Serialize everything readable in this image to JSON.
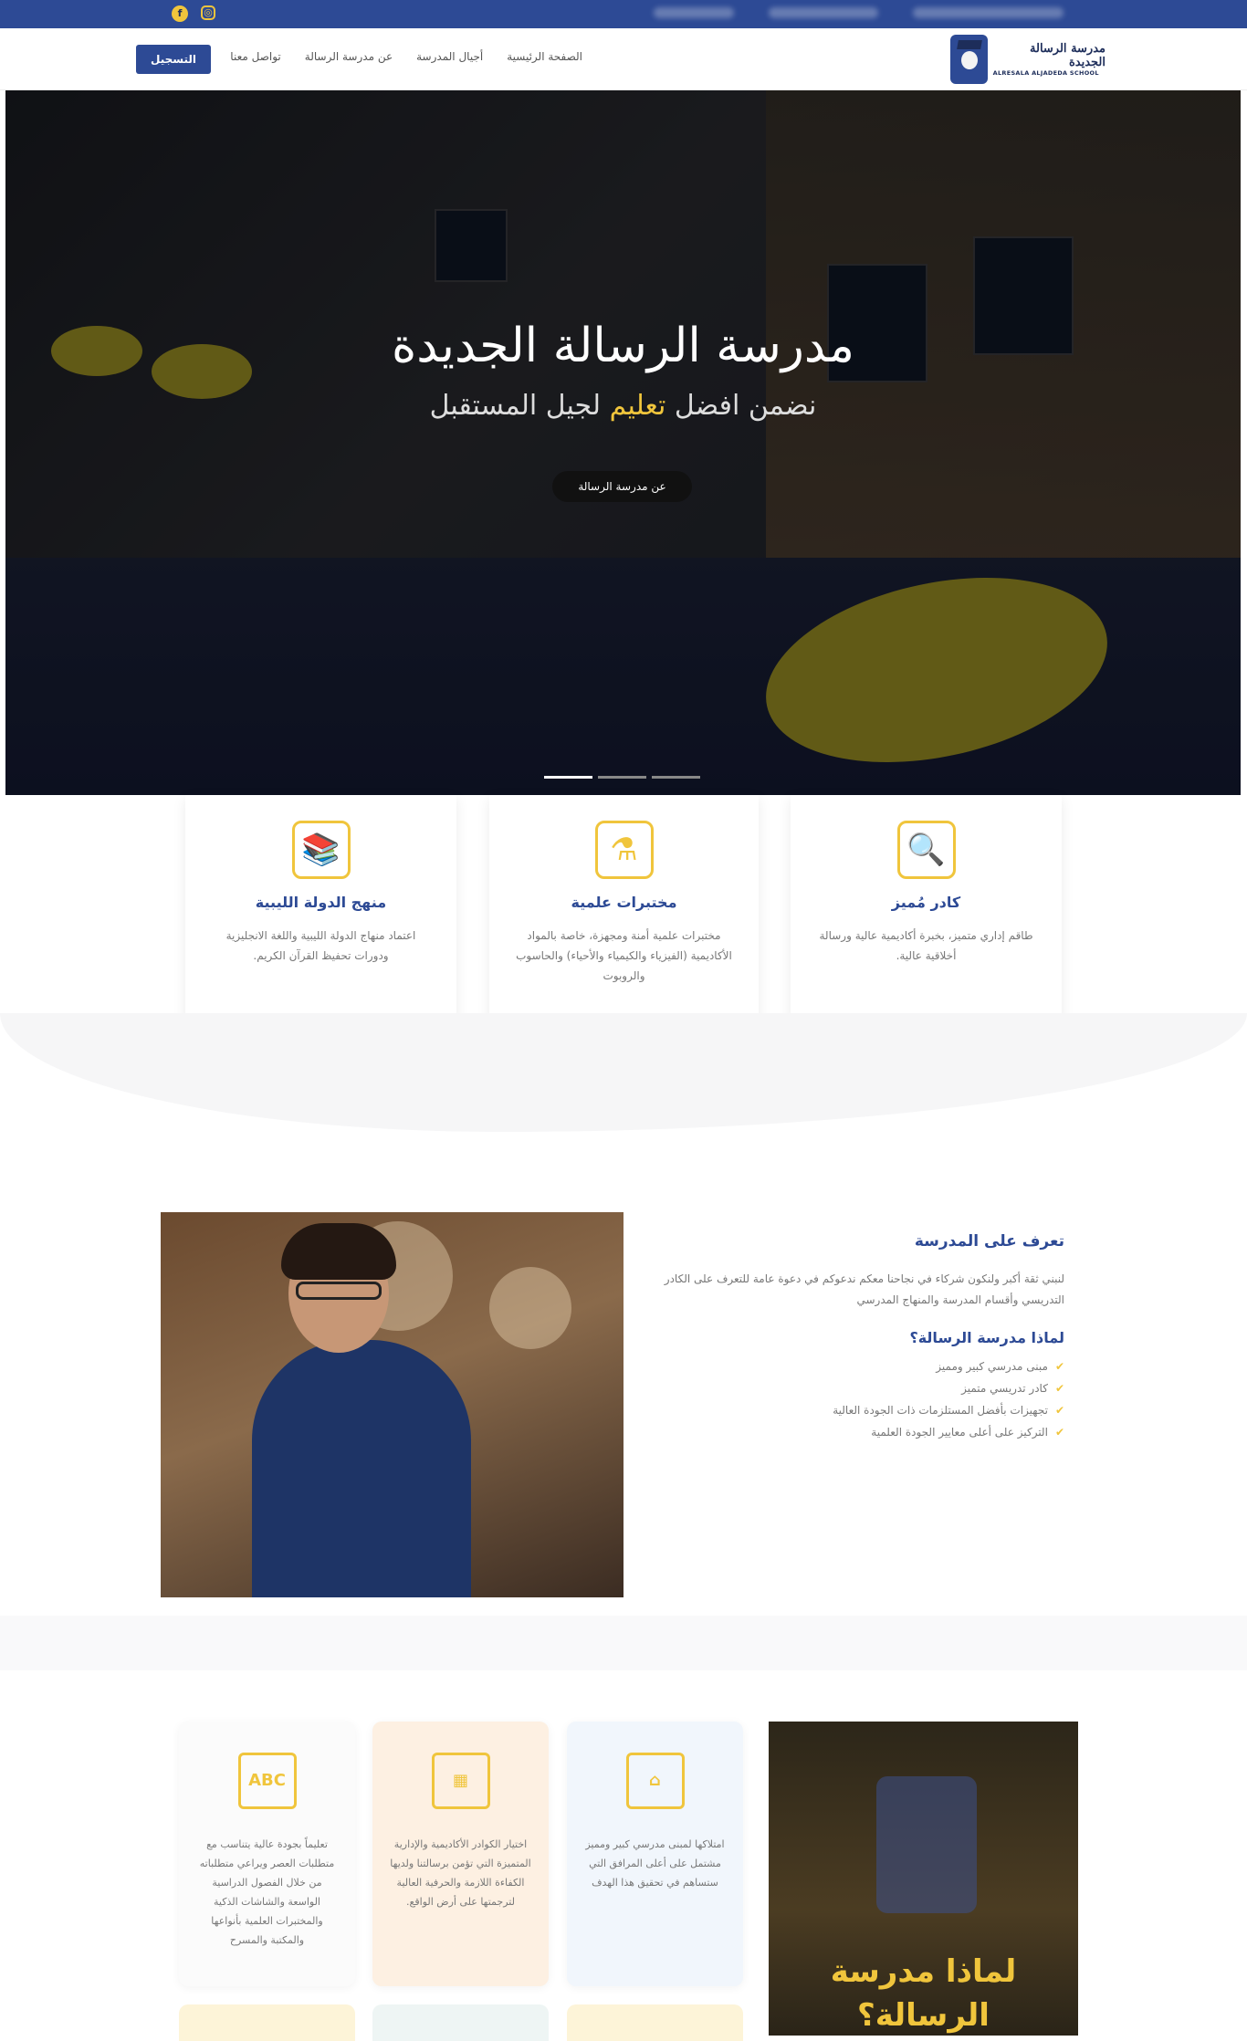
{
  "topbar": {
    "social": [
      {
        "icon": "instagram-icon",
        "glyph": "◎"
      },
      {
        "icon": "facebook-icon",
        "glyph": "f"
      }
    ]
  },
  "nav": {
    "logo_ar": "مدرسة الرسالة الجديدة",
    "logo_en": "ALRESALA ALJADEDA SCHOOL",
    "items": [
      "الصفحة الرئيسية",
      "أجيال المدرسة",
      "عن مدرسة الرسالة",
      "تواصل معنا"
    ],
    "register": "التسجيل"
  },
  "hero": {
    "title": "مدرسة الرسالة الجديدة",
    "sub_before": "نضمن افضل",
    "sub_highlight": "تعليم",
    "sub_after": "لجيل المستقبل",
    "button": "عن مدرسة الرسالة",
    "slides_active": 1
  },
  "features": [
    {
      "icon": "graduate-search-icon",
      "glyph": "🔍",
      "title": "كادر مُميز",
      "text": "طاقم إداري متميز، بخبرة أكاديمية عالية ورسالة أخلاقية عالية."
    },
    {
      "icon": "lab-flask-icon",
      "glyph": "⚗",
      "title": "مختبرات علمية",
      "text": "مختبرات علمية أمنة ومجهزة، خاصة بالمواد الأكاديمية (الفيزياء والكيمياء والأحياء) والحاسوب والروبوت"
    },
    {
      "icon": "books-apple-icon",
      "glyph": "📚",
      "title": "منهج الدولة الليبية",
      "text": "اعتماد منهاج الدولة الليبية واللغة الانجليزية ودورات تحفيظ القرآن الكريم."
    }
  ],
  "about": {
    "title": "تعرف على المدرسة",
    "text": "لنبني ثقة أكبر ولنكون شركاء في نجاحنا معكم ندعوكم في دعوة عامة للتعرف على الكادر التدريسي وأقسام المدرسة والمنهاج المدرسي",
    "why_title": "لماذا مدرسة الرسالة؟",
    "list": [
      "مبنى مدرسي كبير ومميز",
      "كادر تدريسي متميز",
      "تجهيزات بأفضل المستلزمات ذات الجودة العالية",
      "التركيز على أعلى معايير الجودة العلمية"
    ]
  },
  "why": {
    "cards": [
      {
        "icon": "abc-board-icon",
        "glyph": "ABC",
        "bg": "#fbfbfb",
        "text": "تعليماً بجودة عالية يتناسب مع متطلبات العصر ويراعي متطلباته من خلال الفصول الدراسية الواسعة والشاشات الذكية والمختبرات العلمية بأنواعها والمكتبة والمسرح"
      },
      {
        "icon": "teacher-board-icon",
        "glyph": "▦",
        "bg": "#fdf0e2",
        "text": "اختيار الكوادر الأكاديمية والإدارية المتميزة التي تؤمن برسالتنا ولديها الكفاءة اللازمة والحرفية العالية لترجمتها على أرض الواقع."
      },
      {
        "icon": "school-building-icon",
        "glyph": "⌂",
        "bg": "#f1f6fc",
        "text": "امتلاكها لمبنى مدرسي كبير ومميز مشتمل على أعلى المرافق التي ستساهم في تحقيق هذا الهدف"
      }
    ],
    "side_title": "لماذا مدرسة الرسالة؟"
  }
}
